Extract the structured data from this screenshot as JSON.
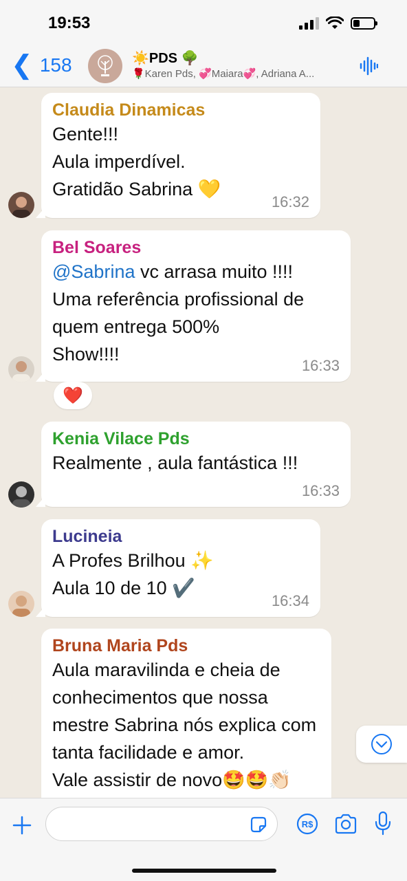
{
  "status_bar": {
    "time": "19:53"
  },
  "header": {
    "back_count": "158",
    "group_name": "☀️PDS 🌳",
    "members": "🌹Karen Pds, 💞Maiara💞, Adriana A..."
  },
  "messages": [
    {
      "sender": "Claudia Dinamicas",
      "sender_color": "#c58a1a",
      "text": "Gente!!!\nAula imperdível.\nGratidão Sabrina 💛",
      "time": "16:32"
    },
    {
      "sender": "Bel Soares",
      "sender_color": "#c7217f",
      "mention": "@Sabrina",
      "text": " vc arrasa muito !!!!\nUma referência profissional de quem entrega 500%\nShow!!!!",
      "time": "16:33",
      "reaction": "❤️"
    },
    {
      "sender": "Kenia Vilace Pds",
      "sender_color": "#2ea12e",
      "text": "Realmente , aula fantástica !!!",
      "time": "16:33"
    },
    {
      "sender": "Lucineia",
      "sender_color": "#3d3b8e",
      "text": "A Profes Brilhou ✨\nAula 10 de 10 ✔️",
      "time": "16:34"
    },
    {
      "sender": "Bruna Maria Pds",
      "sender_color": "#b0451d",
      "text": "Aula maravilinda e cheia de conhecimentos que nossa mestre Sabrina nós explica com tanta facilidade e amor.\nVale assistir de novo🤩🤩👏🏻"
    }
  ],
  "input": {
    "placeholder": ""
  },
  "colors": {
    "accent": "#1877f2",
    "chat_bg": "#efeae2",
    "bubble": "#ffffff"
  }
}
